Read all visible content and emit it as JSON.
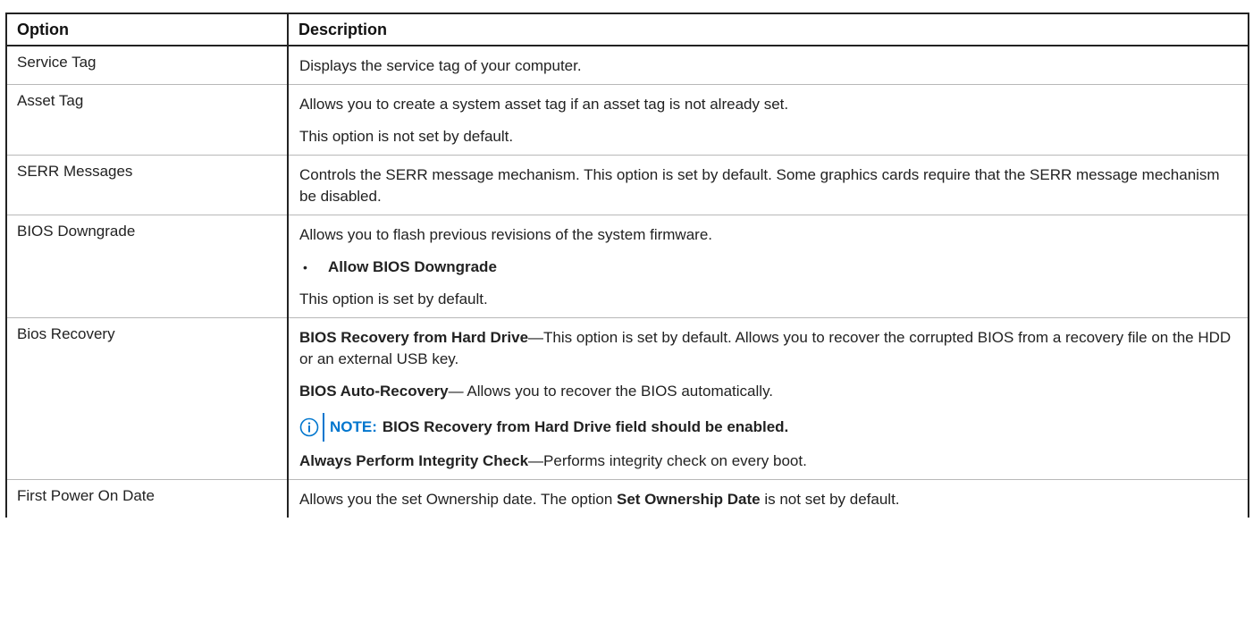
{
  "table": {
    "headers": {
      "option": "Option",
      "description": "Description"
    },
    "rows": [
      {
        "option": "Service Tag",
        "description": [
          {
            "type": "para",
            "text": "Displays the service tag of your computer."
          }
        ]
      },
      {
        "option": "Asset Tag",
        "description": [
          {
            "type": "para",
            "text": "Allows you to create a system asset tag if an asset tag is not already set."
          },
          {
            "type": "para",
            "text": "This option is not set by default."
          }
        ]
      },
      {
        "option": "SERR Messages",
        "description": [
          {
            "type": "para",
            "text": "Controls the SERR message mechanism. This option is set by default. Some graphics cards require that the SERR message mechanism be disabled."
          }
        ]
      },
      {
        "option": "BIOS Downgrade",
        "description": [
          {
            "type": "para",
            "text": "Allows you to flash previous revisions of the system firmware."
          },
          {
            "type": "bullet",
            "bullet": "•",
            "text": "Allow BIOS Downgrade"
          },
          {
            "type": "para",
            "text": "This option is set by default."
          }
        ]
      },
      {
        "option": "Bios Recovery",
        "description": [
          {
            "type": "para",
            "lead": "BIOS Recovery from Hard Drive",
            "text": "—This option is set by default. Allows you to recover the corrupted BIOS from a recovery file on the HDD or an external USB key."
          },
          {
            "type": "para",
            "lead": "BIOS Auto-Recovery",
            "text": "— Allows you to recover the BIOS automatically."
          },
          {
            "type": "note",
            "label": "NOTE:",
            "text": "BIOS Recovery from Hard Drive field should be enabled.",
            "icon": "info-circle-icon"
          },
          {
            "type": "para",
            "lead": "Always Perform Integrity Check",
            "text": "—Performs integrity check on every boot."
          }
        ]
      },
      {
        "option": "First Power On Date",
        "description": [
          {
            "type": "para",
            "text": "Allows you the set Ownership date. The option ",
            "mid_bold": "Set Ownership Date",
            "tail": " is not set by default."
          }
        ]
      }
    ]
  },
  "colors": {
    "note_accent": "#0076ce",
    "border": "#222222",
    "row_divider": "#b8b8b8"
  }
}
